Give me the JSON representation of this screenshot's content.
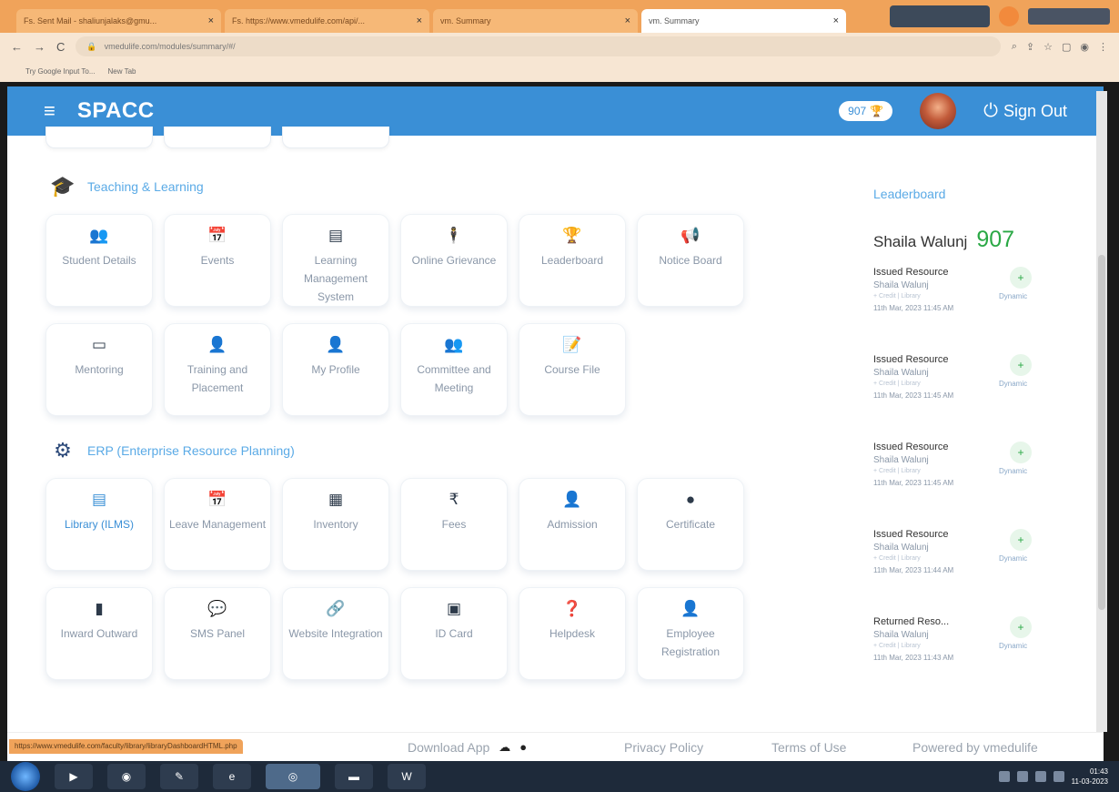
{
  "browser": {
    "tabs": [
      {
        "label": "Fs. Sent Mail - shaliunjalaks@gmu...",
        "active": false
      },
      {
        "label": "Fs. https://www.vmedulife.com/api/...",
        "active": false
      },
      {
        "label": "vm. Summary",
        "active": false
      },
      {
        "label": "vm. Summary",
        "active": true
      }
    ],
    "url": "vmedulife.com/modules/summary/#/",
    "bookmarks": [
      "Try Google Input To...",
      "New Tab"
    ]
  },
  "header": {
    "brand": "SPACC",
    "points": "907",
    "signout_label": "Sign Out"
  },
  "teaching": {
    "title": "Teaching & Learning",
    "cards": [
      {
        "label": "Student Details",
        "icon": "users-icon",
        "glyph": "👥"
      },
      {
        "label": "Events",
        "icon": "calendar-icon",
        "glyph": "📅"
      },
      {
        "label": "Learning Management System",
        "icon": "book-icon",
        "glyph": "▤"
      },
      {
        "label": "Online Grievance",
        "icon": "person-stand-icon",
        "glyph": "🕴"
      },
      {
        "label": "Leaderboard",
        "icon": "trophy-icon",
        "glyph": "🏆"
      },
      {
        "label": "Notice Board",
        "icon": "megaphone-icon",
        "glyph": "📢"
      },
      {
        "label": "Mentoring",
        "icon": "chalkboard-icon",
        "glyph": "▭"
      },
      {
        "label": "Training and Placement",
        "icon": "user-tie-icon",
        "glyph": "👤"
      },
      {
        "label": "My Profile",
        "icon": "user-icon",
        "glyph": "👤"
      },
      {
        "label": "Committee and Meeting",
        "icon": "group-icon",
        "glyph": "👥"
      },
      {
        "label": "Course File",
        "icon": "file-edit-icon",
        "glyph": "📝"
      }
    ]
  },
  "erp": {
    "title": "ERP (Enterprise Resource Planning)",
    "cards": [
      {
        "label": "Library (ILMS)",
        "icon": "library-icon",
        "glyph": "▤",
        "accent": true
      },
      {
        "label": "Leave Management",
        "icon": "calendar-icon",
        "glyph": "📅"
      },
      {
        "label": "Inventory",
        "icon": "archive-icon",
        "glyph": "▦"
      },
      {
        "label": "Fees",
        "icon": "rupee-icon",
        "glyph": "₹"
      },
      {
        "label": "Admission",
        "icon": "user-plus-icon",
        "glyph": "👤"
      },
      {
        "label": "Certificate",
        "icon": "certificate-icon",
        "glyph": "●"
      },
      {
        "label": "Inward Outward",
        "icon": "document-icon",
        "glyph": "▮"
      },
      {
        "label": "SMS Panel",
        "icon": "chat-icon",
        "glyph": "💬"
      },
      {
        "label": "Website Integration",
        "icon": "link-icon",
        "glyph": "🔗"
      },
      {
        "label": "ID Card",
        "icon": "id-card-icon",
        "glyph": "▣"
      },
      {
        "label": "Helpdesk",
        "icon": "question-icon",
        "glyph": "❓"
      },
      {
        "label": "Employee Registration",
        "icon": "user-tie-icon",
        "glyph": "👤"
      }
    ]
  },
  "leaderboard": {
    "title": "Leaderboard",
    "user_name": "Shaila Walunj",
    "score": "907",
    "items": [
      {
        "title": "Issued Resource",
        "name": "Shaila Walunj",
        "sub": "+ Credit | Library",
        "time": "11th Mar, 2023 11:45 AM",
        "tag": "Dynamic"
      },
      {
        "title": "Issued Resource",
        "name": "Shaila Walunj",
        "sub": "+ Credit | Library",
        "time": "11th Mar, 2023 11:45 AM",
        "tag": "Dynamic"
      },
      {
        "title": "Issued Resource",
        "name": "Shaila Walunj",
        "sub": "+ Credit | Library",
        "time": "11th Mar, 2023 11:45 AM",
        "tag": "Dynamic"
      },
      {
        "title": "Issued Resource",
        "name": "Shaila Walunj",
        "sub": "+ Credit | Library",
        "time": "11th Mar, 2023 11:44 AM",
        "tag": "Dynamic"
      },
      {
        "title": "Returned Reso...",
        "name": "Shaila Walunj",
        "sub": "+ Credit | Library",
        "time": "11th Mar, 2023 11:43 AM",
        "tag": "Dynamic"
      }
    ]
  },
  "footer": {
    "download_app": "Download App",
    "privacy": "Privacy Policy",
    "terms": "Terms of Use",
    "powered": "Powered by vmedulife",
    "status_url": "https://www.vmedulife.com/faculty/library/libraryDashboardHTML.php"
  },
  "taskbar": {
    "time": "01:43",
    "date": "11-03-2023"
  }
}
